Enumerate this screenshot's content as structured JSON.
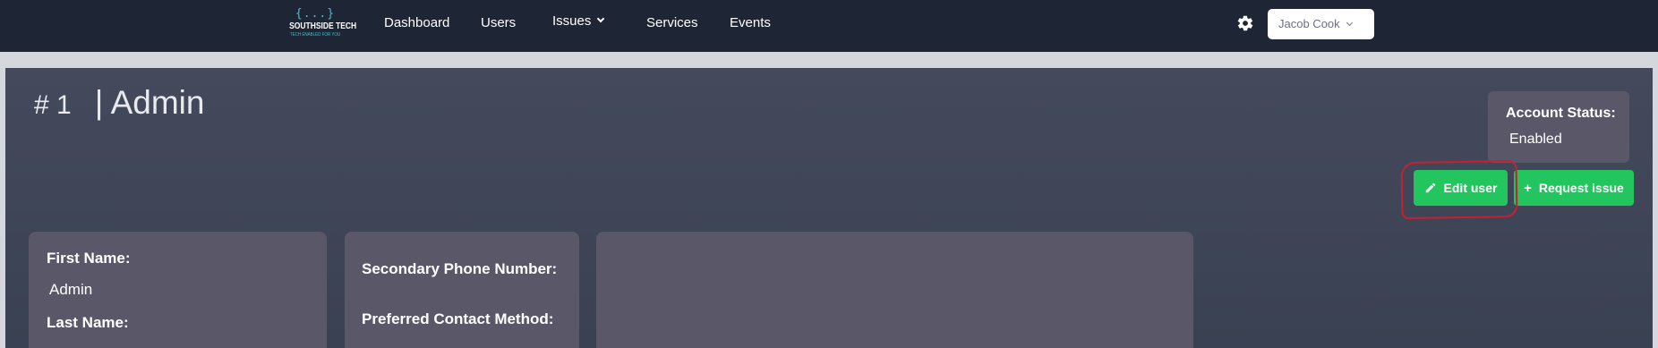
{
  "nav": {
    "logo_brand": "SOUTHSIDE TECH",
    "logo_tagline": "TECH ENABLED FOR YOU",
    "logo_symbol": "{...}",
    "links": [
      "Dashboard",
      "Users",
      "Issues",
      "Services",
      "Events"
    ],
    "user_name": "Jacob Cook",
    "icons": {
      "settings": "gear-icon",
      "user_menu": "chevron-down-icon",
      "issues_menu": "chevron-down-icon"
    }
  },
  "page": {
    "id": "# 1",
    "title": "| Admin"
  },
  "account_status": {
    "label": "Account Status:",
    "value": "Enabled"
  },
  "actions": {
    "edit_user": "Edit user",
    "request_issue": "Request issue"
  },
  "details": {
    "first_name_label": "First Name:",
    "first_name_value": "Admin",
    "last_name_label": "Last Name:",
    "secondary_phone_label": "Secondary Phone Number:",
    "preferred_contact_label": "Preferred Contact Method:"
  },
  "colors": {
    "navbar": "#1e2636",
    "accent_green": "#22c55e",
    "card": "#5a5868",
    "logo_teal": "#3fc3c8",
    "annotation_red": "#c8202e"
  }
}
